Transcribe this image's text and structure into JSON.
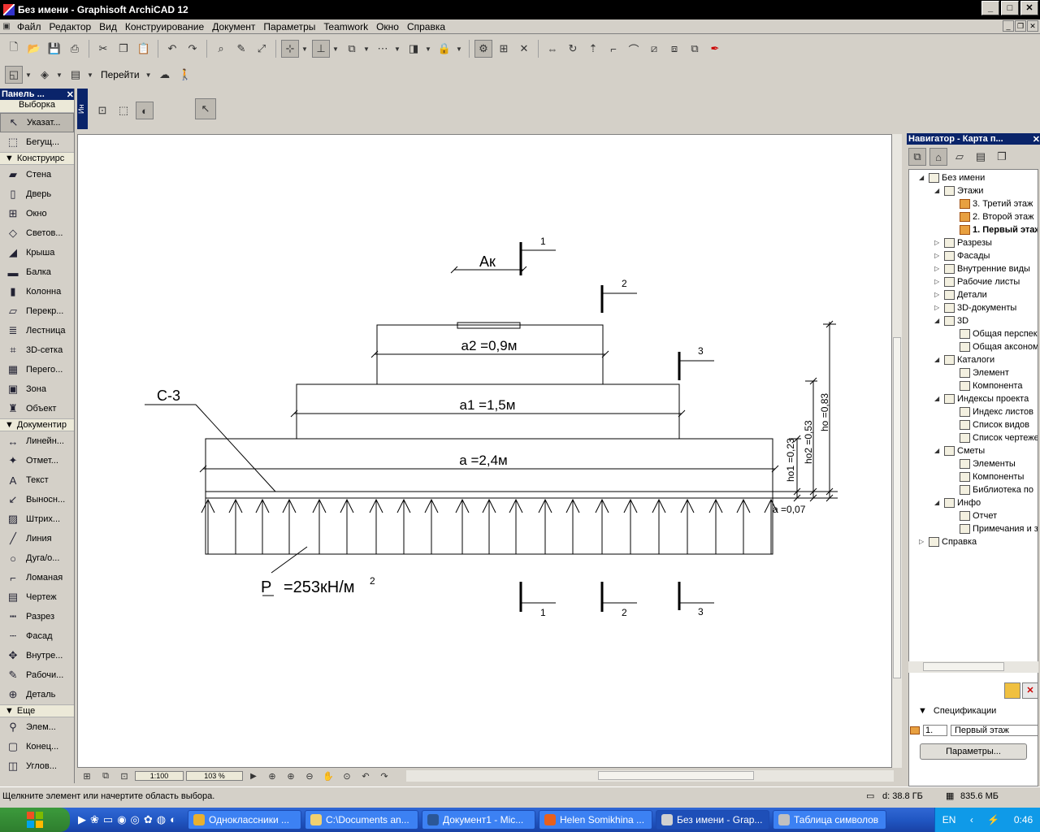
{
  "window": {
    "title": "Без имени - Graphisoft ArchiCAD 12"
  },
  "menu": [
    "Файл",
    "Редактор",
    "Вид",
    "Конструирование",
    "Документ",
    "Параметры",
    "Teamwork",
    "Окно",
    "Справка"
  ],
  "toolbar2": {
    "goto_label": "Перейти"
  },
  "toolbox": {
    "title": "Панель ...",
    "selection_group": "Выборка",
    "selection_tools": [
      {
        "label": "Указат...",
        "icon": "arrow-pointer-icon",
        "glyph": "↖"
      },
      {
        "label": "Бегущ...",
        "icon": "marquee-icon",
        "glyph": "⬚"
      }
    ],
    "design_group": "Конструирс",
    "design_tools": [
      {
        "label": "Стена",
        "icon": "wall-icon",
        "glyph": "▰"
      },
      {
        "label": "Дверь",
        "icon": "door-icon",
        "glyph": "▯"
      },
      {
        "label": "Окно",
        "icon": "window-icon",
        "glyph": "⊞"
      },
      {
        "label": "Светов...",
        "icon": "skylight-icon",
        "glyph": "◇"
      },
      {
        "label": "Крыша",
        "icon": "roof-icon",
        "glyph": "◢"
      },
      {
        "label": "Балка",
        "icon": "beam-icon",
        "glyph": "▬"
      },
      {
        "label": "Колонна",
        "icon": "column-icon",
        "glyph": "▮"
      },
      {
        "label": "Перекр...",
        "icon": "slab-icon",
        "glyph": "▱"
      },
      {
        "label": "Лестница",
        "icon": "stair-icon",
        "glyph": "≣"
      },
      {
        "label": "3D-сетка",
        "icon": "mesh-icon",
        "glyph": "⌗"
      },
      {
        "label": "Перего...",
        "icon": "curtain-wall-icon",
        "glyph": "▦"
      },
      {
        "label": "Зона",
        "icon": "zone-icon",
        "glyph": "▣"
      },
      {
        "label": "Объект",
        "icon": "object-chair-icon",
        "glyph": "♜"
      }
    ],
    "document_group": "Документир",
    "document_tools": [
      {
        "label": "Линейн...",
        "icon": "linear-dimension-icon",
        "glyph": "↔"
      },
      {
        "label": "Отмет...",
        "icon": "level-dimension-icon",
        "glyph": "✦"
      },
      {
        "label": "Текст",
        "icon": "text-icon",
        "glyph": "A"
      },
      {
        "label": "Выносн...",
        "icon": "label-icon",
        "glyph": "↙"
      },
      {
        "label": "Штрих...",
        "icon": "fill-icon",
        "glyph": "▨"
      },
      {
        "label": "Линия",
        "icon": "line-icon",
        "glyph": "╱"
      },
      {
        "label": "Дуга/о...",
        "icon": "arc-circle-icon",
        "glyph": "○"
      },
      {
        "label": "Ломаная",
        "icon": "polyline-icon",
        "glyph": "⌐"
      },
      {
        "label": "Чертеж",
        "icon": "drawing-icon",
        "glyph": "▤"
      },
      {
        "label": "Разрез",
        "icon": "section-icon",
        "glyph": "┅"
      },
      {
        "label": "Фасад",
        "icon": "elevation-icon",
        "glyph": "┄"
      },
      {
        "label": "Внутре...",
        "icon": "interior-elevation-icon",
        "glyph": "✥"
      },
      {
        "label": "Рабочи...",
        "icon": "worksheet-icon",
        "glyph": "✎"
      },
      {
        "label": "Деталь",
        "icon": "detail-icon",
        "glyph": "⊕"
      }
    ],
    "more_group": "Еще",
    "more_tools": [
      {
        "label": "Элем...",
        "icon": "element-icon",
        "glyph": "⚲"
      },
      {
        "label": "Конец...",
        "icon": "end-icon",
        "glyph": "▢"
      },
      {
        "label": "Углов...",
        "icon": "corner-icon",
        "glyph": "◫"
      }
    ]
  },
  "infobox": {
    "tab": "Ин"
  },
  "drawing": {
    "label_ak": "Ак",
    "label_c3": "С-3",
    "dim_a2": "а2 =0,9м",
    "dim_a1": "а1 =1,5м",
    "dim_a": "а =2,4м",
    "pressure_p": "Р",
    "pressure_value": "=253кН/м",
    "pressure_exp": "2",
    "h01": "hо1 =0,23",
    "h02": "hо2 =0,53",
    "h0": "hо =0,83",
    "a_07": "а =0,07",
    "sections": [
      "1",
      "2",
      "3"
    ]
  },
  "bottombar": {
    "scale": "1:100",
    "zoom": "103 %"
  },
  "navigator": {
    "title": "Навигатор - Карта п...",
    "tree": [
      {
        "label": "Без имени",
        "level": 0,
        "icon": "project-house-icon"
      },
      {
        "label": "Этажи",
        "level": 1,
        "icon": "stories-icon"
      },
      {
        "label": "3. Третий этаж",
        "level": 2,
        "icon": "story-icon"
      },
      {
        "label": "2. Второй этаж",
        "level": 2,
        "icon": "story-icon"
      },
      {
        "label": "1. Первый этаж",
        "level": 2,
        "icon": "story-icon",
        "bold": true
      },
      {
        "label": "Разрезы",
        "level": 1,
        "icon": "sections-icon"
      },
      {
        "label": "Фасады",
        "level": 1,
        "icon": "elevations-icon"
      },
      {
        "label": "Внутренние виды",
        "level": 1,
        "icon": "interior-views-icon"
      },
      {
        "label": "Рабочие листы",
        "level": 1,
        "icon": "worksheets-icon"
      },
      {
        "label": "Детали",
        "level": 1,
        "icon": "details-icon"
      },
      {
        "label": "3D-документы",
        "level": 1,
        "icon": "3d-documents-icon"
      },
      {
        "label": "3D",
        "level": 1,
        "icon": "3d-icon"
      },
      {
        "label": "Общая перспектива",
        "level": 2,
        "icon": "perspective-icon"
      },
      {
        "label": "Общая аксонометрия",
        "level": 2,
        "icon": "axonometry-icon"
      },
      {
        "label": "Каталоги",
        "level": 1,
        "icon": "catalogs-icon"
      },
      {
        "label": "Элемент",
        "level": 2,
        "icon": "catalog-element-icon"
      },
      {
        "label": "Компонента",
        "level": 2,
        "icon": "catalog-component-icon"
      },
      {
        "label": "Индексы проекта",
        "level": 1,
        "icon": "project-index-icon"
      },
      {
        "label": "Индекс листов",
        "level": 2,
        "icon": "sheet-index-icon"
      },
      {
        "label": "Список видов",
        "level": 2,
        "icon": "view-list-icon"
      },
      {
        "label": "Список чертежей",
        "level": 2,
        "icon": "drawing-list-icon"
      },
      {
        "label": "Сметы",
        "level": 1,
        "icon": "estimates-icon"
      },
      {
        "label": "Элементы",
        "level": 2,
        "icon": "estimate-elements-icon"
      },
      {
        "label": "Компоненты",
        "level": 2,
        "icon": "estimate-components-icon"
      },
      {
        "label": "Библиотека по",
        "level": 2,
        "icon": "library-icon"
      },
      {
        "label": "Инфо",
        "level": 1,
        "icon": "info-icon"
      },
      {
        "label": "Отчет",
        "level": 2,
        "icon": "report-icon"
      },
      {
        "label": "Примечания и з",
        "level": 2,
        "icon": "notes-icon"
      },
      {
        "label": "Справка",
        "level": 0,
        "icon": "help-icon"
      }
    ],
    "specs_label": "Спецификации",
    "story_num": "1.",
    "story_name": "Первый этаж",
    "params_button": "Параметры..."
  },
  "status": {
    "hint": "Щелкните элемент или начертите область выбора.",
    "disk": "d: 38.8 ГБ",
    "memory": "835.6 МБ"
  },
  "taskbar": {
    "items": [
      {
        "label": "Одноклассники ...",
        "color": "#e8b030"
      },
      {
        "label": "C:\\Documents an...",
        "color": "#f0d070"
      },
      {
        "label": "Документ1 - Mic...",
        "color": "#2b5797"
      },
      {
        "label": "Helen Somikhina ...",
        "color": "#e8601c"
      },
      {
        "label": "Без имени - Grap...",
        "color": "#d0d0d0",
        "active": true
      },
      {
        "label": "Таблица символов",
        "color": "#c0c0c0"
      }
    ],
    "lang": "EN",
    "time": "0:46"
  }
}
